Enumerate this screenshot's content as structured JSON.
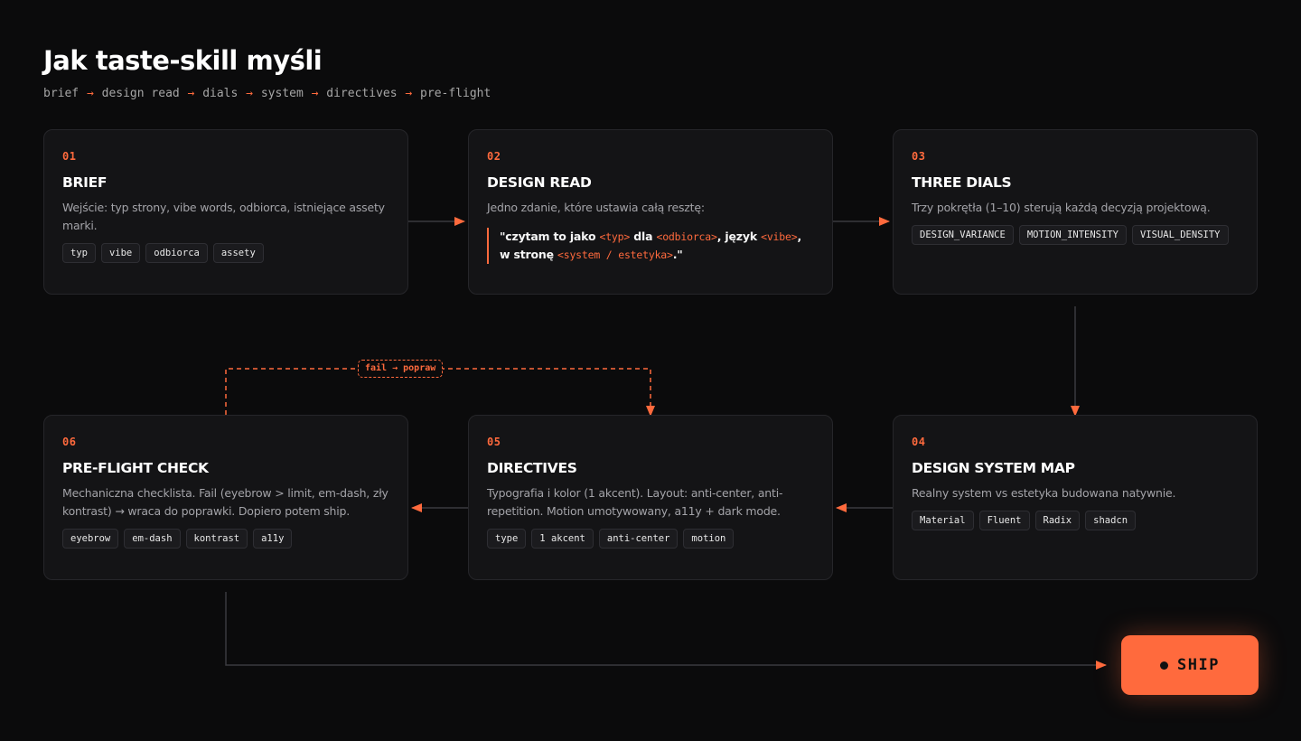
{
  "header": {
    "title": "Jak taste-skill myśli",
    "flow": [
      "brief",
      "design read",
      "dials",
      "system",
      "directives",
      "pre-flight"
    ],
    "flow_arrow": "→"
  },
  "colors": {
    "accent": "#ff6a3d",
    "background": "#0b0b0c",
    "card": "#141416"
  },
  "steps": [
    {
      "num": "01",
      "title": "BRIEF",
      "desc": "Wejście: typ strony, vibe words, odbiorca, istniejące assety marki.",
      "tags": [
        "typ",
        "vibe",
        "odbiorca",
        "assety"
      ]
    },
    {
      "num": "02",
      "title": "DESIGN READ",
      "desc": "Jedno zdanie, które ustawia całą resztę:",
      "quote": {
        "p1": "\"czytam to jako ",
        "ph1": "<typ>",
        "p2": " dla ",
        "ph2": "<odbiorca>",
        "p3": ", język ",
        "ph3": "<vibe>",
        "p4": ", w stronę ",
        "ph4": "<system / estetyka>",
        "p5": ".\""
      }
    },
    {
      "num": "03",
      "title": "THREE DIALS",
      "desc": "Trzy pokrętła (1–10) sterują każdą decyzją projektową.",
      "tags": [
        "DESIGN_VARIANCE",
        "MOTION_INTENSITY",
        "VISUAL_DENSITY"
      ]
    },
    {
      "num": "04",
      "title": "DESIGN SYSTEM MAP",
      "desc": "Realny system vs estetyka budowana natywnie.",
      "tags": [
        "Material",
        "Fluent",
        "Radix",
        "shadcn"
      ]
    },
    {
      "num": "05",
      "title": "DIRECTIVES",
      "desc": "Typografia i kolor (1 akcent). Layout: anti-center, anti-repetition. Motion umotywowany, a11y + dark mode.",
      "tags": [
        "type",
        "1 akcent",
        "anti-center",
        "motion"
      ]
    },
    {
      "num": "06",
      "title": "PRE-FLIGHT CHECK",
      "desc": "Mechaniczna checklista. Fail (eyebrow > limit, em-dash, zły kontrast) → wraca do poprawki. Dopiero potem ship.",
      "tags": [
        "eyebrow",
        "em-dash",
        "kontrast",
        "a11y"
      ]
    }
  ],
  "loop_label": "fail → popraw",
  "ship_label": "SHIP"
}
